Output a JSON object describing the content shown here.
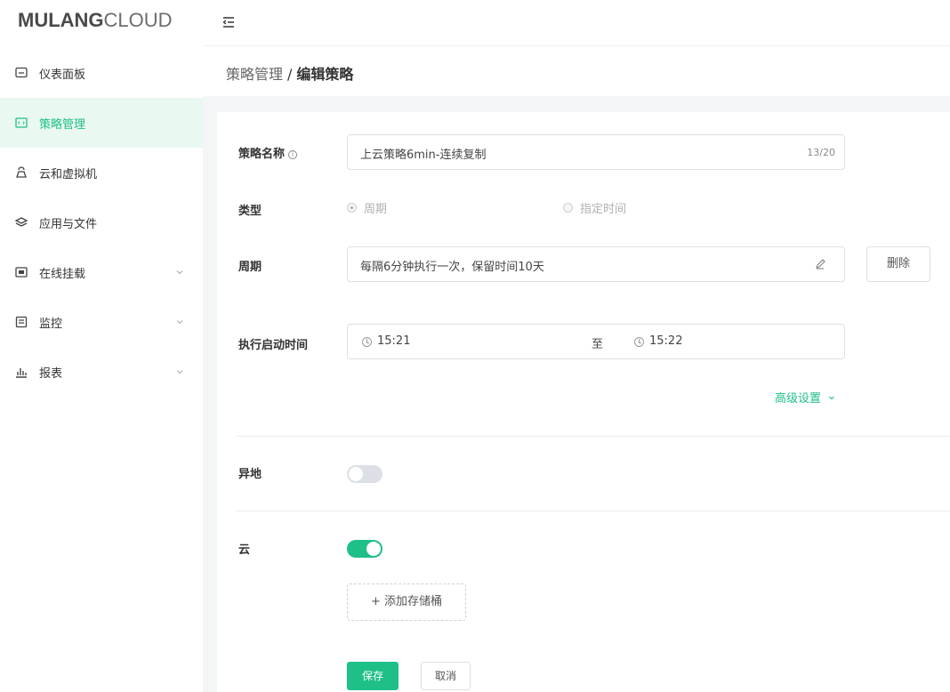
{
  "brand": {
    "part1": "MULANG",
    "part2": "CLOUD"
  },
  "sidebar": {
    "items": [
      {
        "label": "仪表面板",
        "icon": "dashboard-icon"
      },
      {
        "label": "策略管理",
        "icon": "strategy-icon",
        "active": true
      },
      {
        "label": "云和虚拟机",
        "icon": "cloud-vm-icon"
      },
      {
        "label": "应用与文件",
        "icon": "layers-icon"
      },
      {
        "label": "在线挂载",
        "icon": "mount-icon",
        "expandable": true
      },
      {
        "label": "监控",
        "icon": "monitor-icon",
        "expandable": true
      },
      {
        "label": "报表",
        "icon": "report-icon",
        "expandable": true
      }
    ]
  },
  "breadcrumb": {
    "parent": "策略管理",
    "separator": "/",
    "current": "编辑策略"
  },
  "form": {
    "name": {
      "label": "策略名称",
      "value": "上云策略6min-连续复制",
      "count": "13/20"
    },
    "type": {
      "label": "类型",
      "options": [
        "周期",
        "指定时间"
      ],
      "selected": "周期"
    },
    "period": {
      "label": "周期",
      "value": "每隔6分钟执行一次，保留时间10天",
      "delete_label": "删除"
    },
    "start_time": {
      "label": "执行启动时间",
      "from": "15:21",
      "to_label": "至",
      "to": "15:22"
    },
    "advanced_label": "高级设置",
    "remote": {
      "label": "异地",
      "enabled": false
    },
    "cloud": {
      "label": "云",
      "enabled": true
    },
    "add_bucket_label": "+ 添加存储桶",
    "save_label": "保存",
    "cancel_label": "取消"
  },
  "colors": {
    "accent": "#1fbf88",
    "active_bg": "#e9f8f1"
  }
}
